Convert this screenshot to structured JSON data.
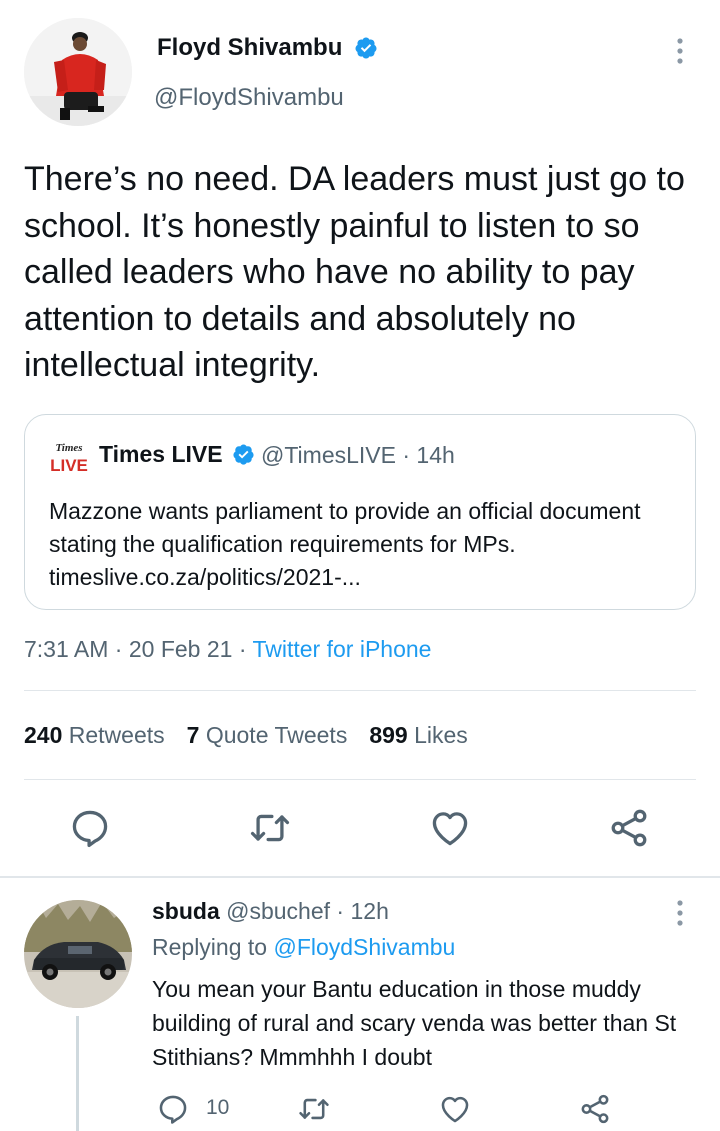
{
  "author": {
    "display_name": "Floyd Shivambu",
    "handle": "@FloydShivambu",
    "verified": true
  },
  "tweet": {
    "text": "There’s no need. DA leaders must just go to school. It’s honestly painful to listen to so called leaders who have no ability to pay attention to details and absolutely no intellectual integrity.",
    "time": "7:31 AM",
    "date": "20 Feb 21",
    "source": "Twitter for iPhone",
    "separator": "·"
  },
  "quoted": {
    "logo_text_top": "Times",
    "logo_text_bottom": "LIVE",
    "name": "Times LIVE",
    "handle": "@TimesLIVE",
    "age": "14h",
    "text": "Mazzone wants parliament to provide an official document stating the qualification requirements for MPs. timeslive.co.za/politics/2021-..."
  },
  "stats": {
    "retweets_count": "240",
    "retweets_label": "Retweets",
    "quotes_count": "7",
    "quotes_label": "Quote Tweets",
    "likes_count": "899",
    "likes_label": "Likes"
  },
  "icons": [
    "reply-icon",
    "retweet-icon",
    "like-icon",
    "share-icon",
    "more-icon",
    "verified-badge-icon"
  ],
  "colors": {
    "accent": "#1d9bf0",
    "text": "#0f1419",
    "muted": "#536471",
    "border": "#cfd9de"
  },
  "reply": {
    "name": "sbuda",
    "handle": "@sbuchef",
    "age": "12h",
    "replying_prefix": "Replying to",
    "replying_to": "@FloydShivambu",
    "text": "You mean your Bantu education in those muddy building of rural and scary venda was better than St Stithians? Mmmhhh I doubt",
    "reply_count": "10"
  }
}
